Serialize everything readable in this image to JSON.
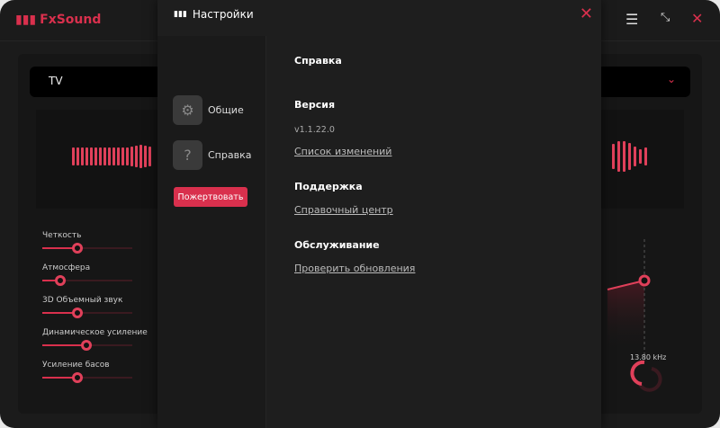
{
  "app": {
    "title": "FxSound",
    "preset": "TV"
  },
  "effects": [
    {
      "label": "Четкость",
      "value": 0.39
    },
    {
      "label": "Атмосфера",
      "value": 0.2
    },
    {
      "label": "3D Объемный звук",
      "value": 0.39
    },
    {
      "label": "Динамическое усиление",
      "value": 0.49
    },
    {
      "label": "Усиление басов",
      "value": 0.39
    }
  ],
  "eq": {
    "freq_label": "13.80 kHz"
  },
  "settings": {
    "title": "Настройки",
    "nav": [
      {
        "label": "Общие"
      },
      {
        "label": "Справка"
      }
    ],
    "donate": "Пожертвовать",
    "section_title": "Справка",
    "version_title": "Версия",
    "version": "v1.1.22.0",
    "changelog": "Список изменений",
    "support_title": "Поддержка",
    "help_center": "Справочный центр",
    "maintenance_title": "Обслуживание",
    "check_updates": "Проверить обновления"
  },
  "colors": {
    "accent": "#d9304d"
  }
}
